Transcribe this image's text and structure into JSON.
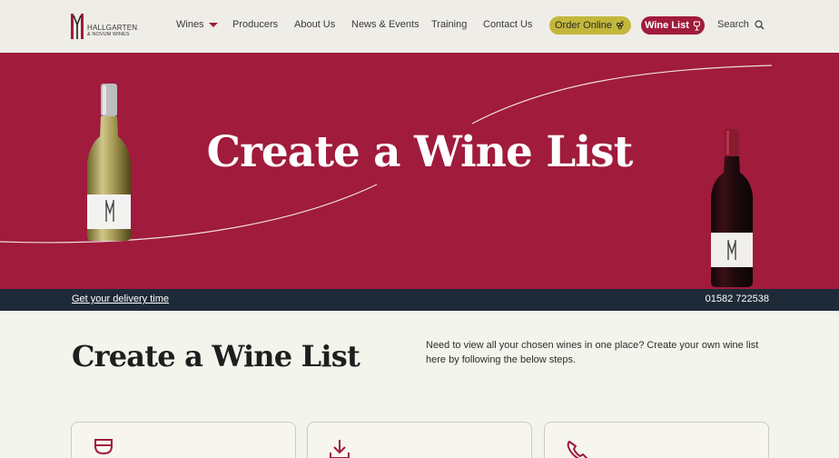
{
  "brand": {
    "line1": "HALLGARTEN",
    "line2": "& NOVUM WINES"
  },
  "nav": {
    "wines": "Wines",
    "producers": "Producers",
    "about": "About Us",
    "news": "News & Events",
    "training": "Training",
    "contact": "Contact Us",
    "order_online": "Order Online",
    "wine_list": "Wine List",
    "search": "Search"
  },
  "hero": {
    "title": "Create a Wine List"
  },
  "delivery_bar": {
    "link": "Get your delivery time",
    "phone": "01582 722538"
  },
  "main": {
    "title": "Create a Wine List",
    "intro": "Need to view all your chosen wines in one place? Create your own wine list here by following the below steps."
  },
  "cards": [
    {
      "icon": "wine-glass-icon"
    },
    {
      "icon": "download-icon"
    },
    {
      "icon": "phone-icon"
    }
  ],
  "colors": {
    "brand_red": "#a01b3c",
    "navy": "#1f2a38",
    "order_yellow": "#c3b73b",
    "header_bg": "#efede7",
    "page_bg": "#f3f4ec"
  }
}
